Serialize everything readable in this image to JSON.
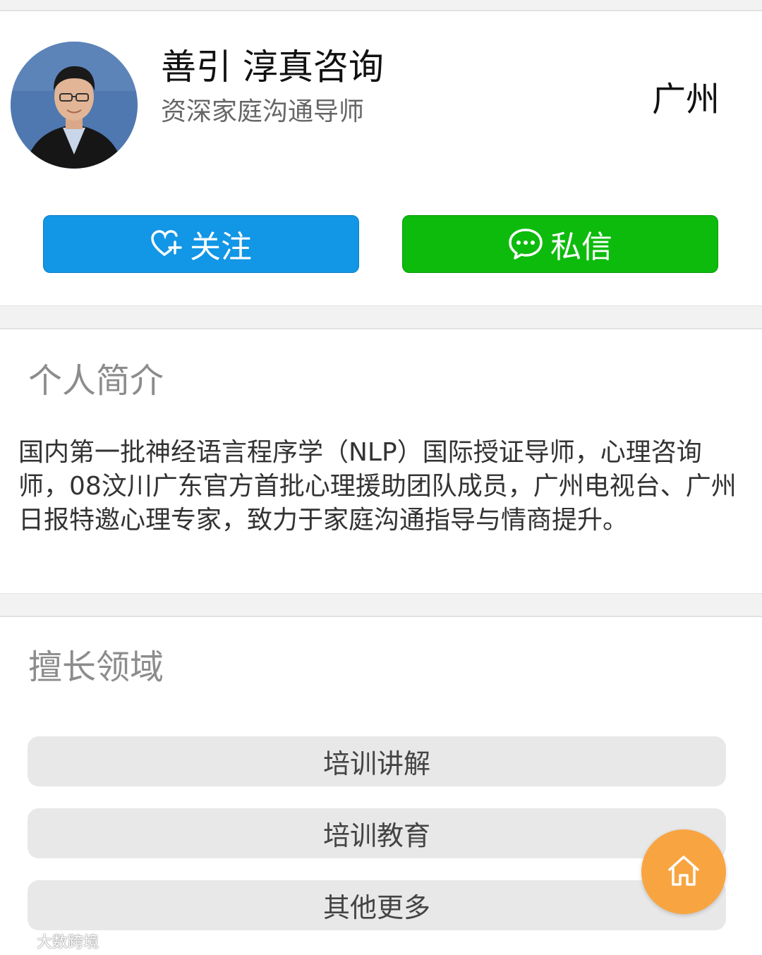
{
  "profile": {
    "name": "善引 淳真咨询",
    "title": "资深家庭沟通导师",
    "location": "广州"
  },
  "actions": {
    "follow_label": "关注",
    "message_label": "私信",
    "follow_icon": "heart-plus-icon",
    "message_icon": "chat-bubble-icon",
    "follow_color": "#1296e6",
    "message_color": "#0dbb0d"
  },
  "intro": {
    "heading": "个人简介",
    "text": "国内第一批神经语言程序学（NLP）国际授证导师，心理咨询师，08汶川广东官方首批心理援助团队成员，广州电视台、广州日报特邀心理专家，致力于家庭沟通指导与情商提升。"
  },
  "expertise": {
    "heading": "擅长领域",
    "items": [
      "培训讲解",
      "培训教育",
      "其他更多"
    ]
  },
  "fab": {
    "icon": "home-icon",
    "color": "#f8a541"
  },
  "watermark": {
    "text": "大数跨境"
  }
}
